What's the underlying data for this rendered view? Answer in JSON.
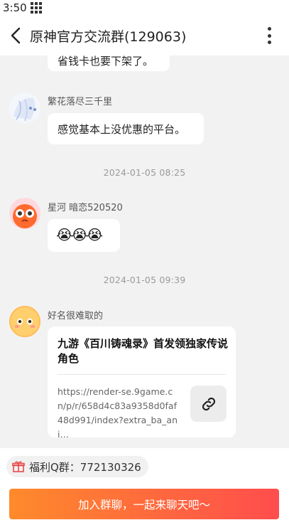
{
  "status_bar": {
    "time": "3:50"
  },
  "header": {
    "title": "原神官方交流群(129063)"
  },
  "messages": [
    {
      "text": "省钱卡也要下架了。"
    },
    {
      "sender": "繁花落尽三千里",
      "text": "感觉基本上没优惠的平台。"
    },
    {
      "timestamp": "2024-01-05   08:25"
    },
    {
      "sender": "星河 暗恋520520",
      "emoji": "😭😭😭"
    },
    {
      "timestamp": "2024-01-05   09:39"
    },
    {
      "sender": "好名很难取的",
      "card": {
        "title": "九游《百川铸魂录》首发领独家传说角色",
        "url": "https://render-se.9game.cn/p/r/658d4c83a9358d0faf48d991/index?extra_ba_ani…"
      }
    }
  ],
  "bottom": {
    "qq_group_label": "福利Q群：772130326",
    "join_button": "加入群聊，一起来聊天吧～"
  },
  "icons": {
    "back": "chevron-left-icon",
    "more": "more-vertical-icon",
    "link": "link-icon",
    "gift": "gift-icon",
    "status": "grid-icon"
  },
  "colors": {
    "accent_gradient_start": "#ff8a2b",
    "accent_gradient_end": "#ff4d4d",
    "gift_red": "#e84a4a"
  }
}
